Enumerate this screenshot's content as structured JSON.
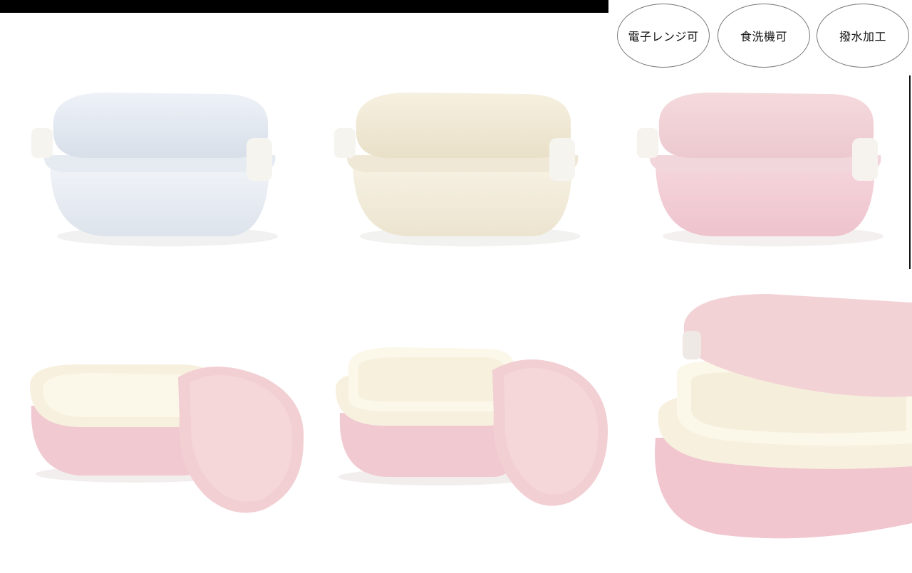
{
  "badges": [
    {
      "label": "電子レンジ可"
    },
    {
      "label": "食洗機可"
    },
    {
      "label": "撥水加工"
    }
  ],
  "products": {
    "colors": {
      "white": "#e9eef5",
      "cream": "#f2ecdc",
      "pink": "#f3ccd4",
      "inner_tray": "#fbf6e8",
      "clip": "#f3f0ea"
    }
  }
}
